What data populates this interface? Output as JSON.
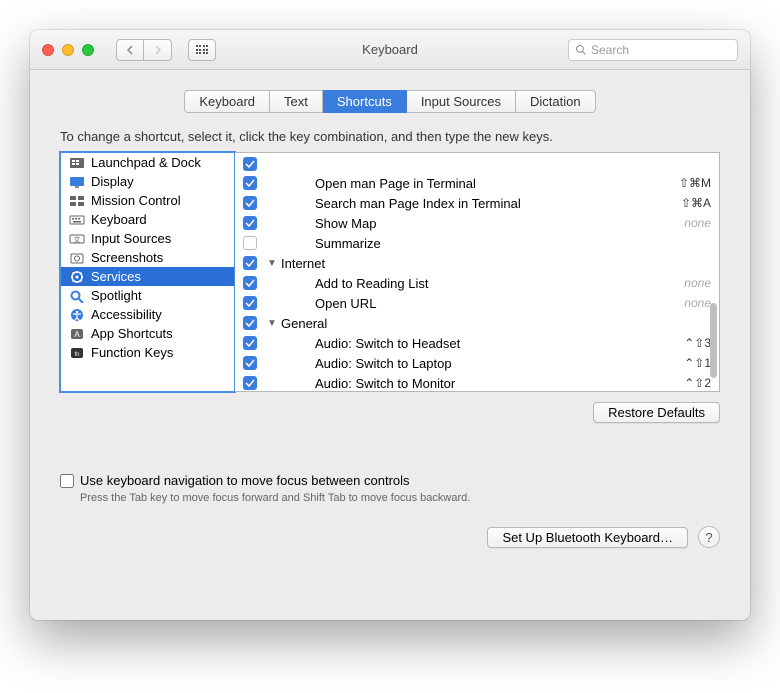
{
  "window": {
    "title": "Keyboard",
    "search_placeholder": "Search"
  },
  "tabs": [
    "Keyboard",
    "Text",
    "Shortcuts",
    "Input Sources",
    "Dictation"
  ],
  "active_tab": 2,
  "instruction": "To change a shortcut, select it, click the key combination, and then type the new keys.",
  "categories": [
    {
      "label": "Launchpad & Dock",
      "icon": "launchpad"
    },
    {
      "label": "Display",
      "icon": "display"
    },
    {
      "label": "Mission Control",
      "icon": "mission"
    },
    {
      "label": "Keyboard",
      "icon": "keyboard"
    },
    {
      "label": "Input Sources",
      "icon": "input"
    },
    {
      "label": "Screenshots",
      "icon": "screenshot"
    },
    {
      "label": "Services",
      "icon": "services",
      "selected": true
    },
    {
      "label": "Spotlight",
      "icon": "spotlight"
    },
    {
      "label": "Accessibility",
      "icon": "accessibility"
    },
    {
      "label": "App Shortcuts",
      "icon": "app"
    },
    {
      "label": "Function Keys",
      "icon": "fn"
    }
  ],
  "services": [
    {
      "checked": true,
      "label": "Open man Page in Terminal",
      "key": "⇧⌘M",
      "indent": 2
    },
    {
      "checked": true,
      "label": "Search man Page Index in Terminal",
      "key": "⇧⌘A",
      "indent": 2
    },
    {
      "checked": true,
      "label": "Show Map",
      "key": "none",
      "indent": 2
    },
    {
      "checked": false,
      "label": "Summarize",
      "key": "",
      "indent": 2
    },
    {
      "checked": true,
      "label": "Internet",
      "group": true,
      "indent": 0
    },
    {
      "checked": true,
      "label": "Add to Reading List",
      "key": "none",
      "indent": 2
    },
    {
      "checked": true,
      "label": "Open URL",
      "key": "none",
      "indent": 2
    },
    {
      "checked": true,
      "label": "General",
      "group": true,
      "indent": 0
    },
    {
      "checked": true,
      "label": "Audio: Switch to Headset",
      "key": "⌃⇧3",
      "indent": 2
    },
    {
      "checked": true,
      "label": "Audio: Switch to Laptop",
      "key": "⌃⇧1",
      "indent": 2
    },
    {
      "checked": true,
      "label": "Audio: Switch to Monitor",
      "key": "⌃⇧2",
      "indent": 2
    }
  ],
  "restore_label": "Restore Defaults",
  "kbnav_label": "Use keyboard navigation to move focus between controls",
  "kbnav_hint": "Press the Tab key to move focus forward and Shift Tab to move focus backward.",
  "bluetooth_label": "Set Up Bluetooth Keyboard…",
  "help_label": "?"
}
